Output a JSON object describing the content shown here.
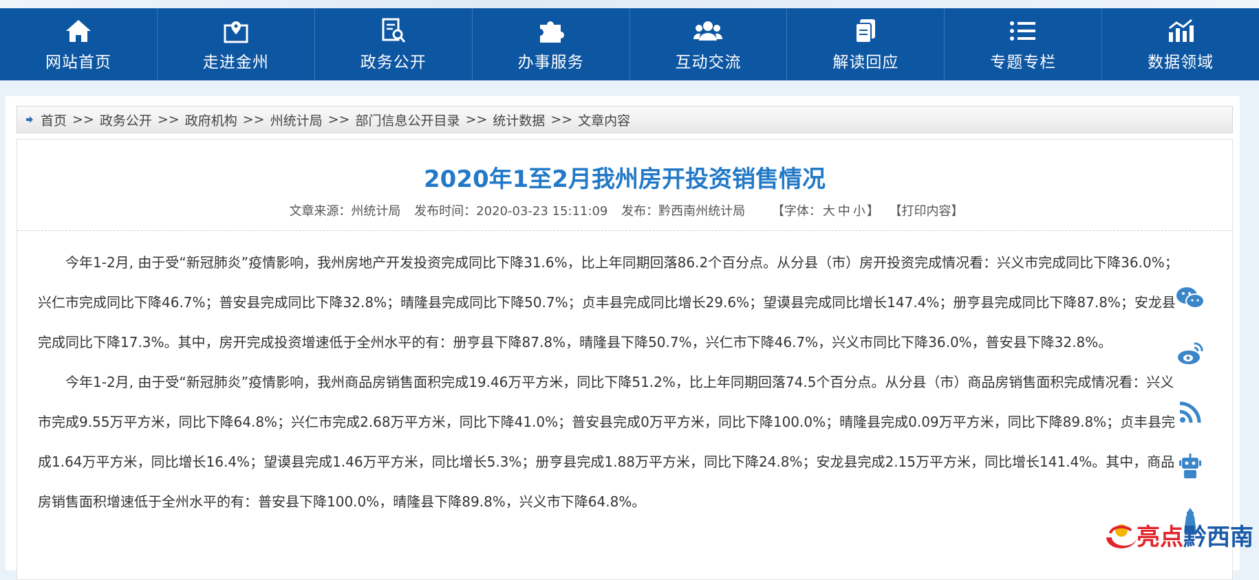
{
  "nav": {
    "items": [
      {
        "label": "网站首页",
        "icon": "home-icon"
      },
      {
        "label": "走进金州",
        "icon": "map-pin-icon"
      },
      {
        "label": "政务公开",
        "icon": "document-search-icon"
      },
      {
        "label": "办事服务",
        "icon": "puzzle-icon"
      },
      {
        "label": "互动交流",
        "icon": "people-icon"
      },
      {
        "label": "解读回应",
        "icon": "files-icon"
      },
      {
        "label": "专题专栏",
        "icon": "list-icon"
      },
      {
        "label": "数据领域",
        "icon": "chart-icon"
      }
    ]
  },
  "breadcrumb": {
    "items": [
      "首页",
      "政务公开",
      "政府机构",
      "州统计局",
      "部门信息公开目录",
      "统计数据",
      "文章内容"
    ],
    "separator": ">>"
  },
  "article": {
    "title": "2020年1至2月我州房开投资销售情况",
    "meta": {
      "source": "文章来源：州统计局",
      "time": "发布时间：2020-03-23 15:11:09",
      "publisher": "发布：黔西南州统计局",
      "font_label": "【字体：",
      "font_large": "大",
      "font_medium": "中",
      "font_small": "小",
      "font_end": "】",
      "print": "【打印内容】"
    },
    "paragraphs": [
      "今年1-2月, 由于受“新冠肺炎”疫情影响，我州房地产开发投资完成同比下降31.6%，比上年同期回落86.2个百分点。从分县（市）房开投资完成情况看：兴义市完成同比下降36.0%；兴仁市完成同比下降46.7%；普安县完成同比下降32.8%；晴隆县完成同比下降50.7%；贞丰县完成同比增长29.6%；望谟县完成同比增长147.4%；册亨县完成同比下降87.8%；安龙县完成同比下降17.3%。其中，房开完成投资增速低于全州水平的有：册亨县下降87.8%，晴隆县下降50.7%，兴仁市下降46.7%，兴义市同比下降36.0%，普安县下降32.8%。",
      "今年1-2月, 由于受“新冠肺炎”疫情影响，我州商品房销售面积完成19.46万平方米，同比下降51.2%，比上年同期回落74.5个百分点。从分县（市）商品房销售面积完成情况看：兴义市完成9.55万平方米，同比下降64.8%；兴仁市完成2.68万平方米，同比下降41.0%；普安县完成0万平方米，同比下降100.0%；晴隆县完成0.09万平方米，同比下降89.8%；贞丰县完成1.64万平方米，同比增长16.4%；望谟县完成1.46万平方米，同比增长5.3%；册亨县完成1.88万平方米，同比下降24.8%；安龙县完成2.15万平方米，同比增长141.4%。其中，商品房销售面积增速低于全州水平的有：普安县下降100.0%，晴隆县下降89.8%，兴义市下降64.8%。"
    ]
  },
  "share": {
    "icons": [
      "wechat-icon",
      "weibo-icon",
      "rss-icon",
      "robot-icon",
      "lighthouse-icon"
    ]
  },
  "logo": {
    "text_red": "亮点",
    "text_blue": "黔西南"
  },
  "colors": {
    "nav_bg": "#0d56a2",
    "title": "#2279c7",
    "logo_red": "#e0262b"
  }
}
